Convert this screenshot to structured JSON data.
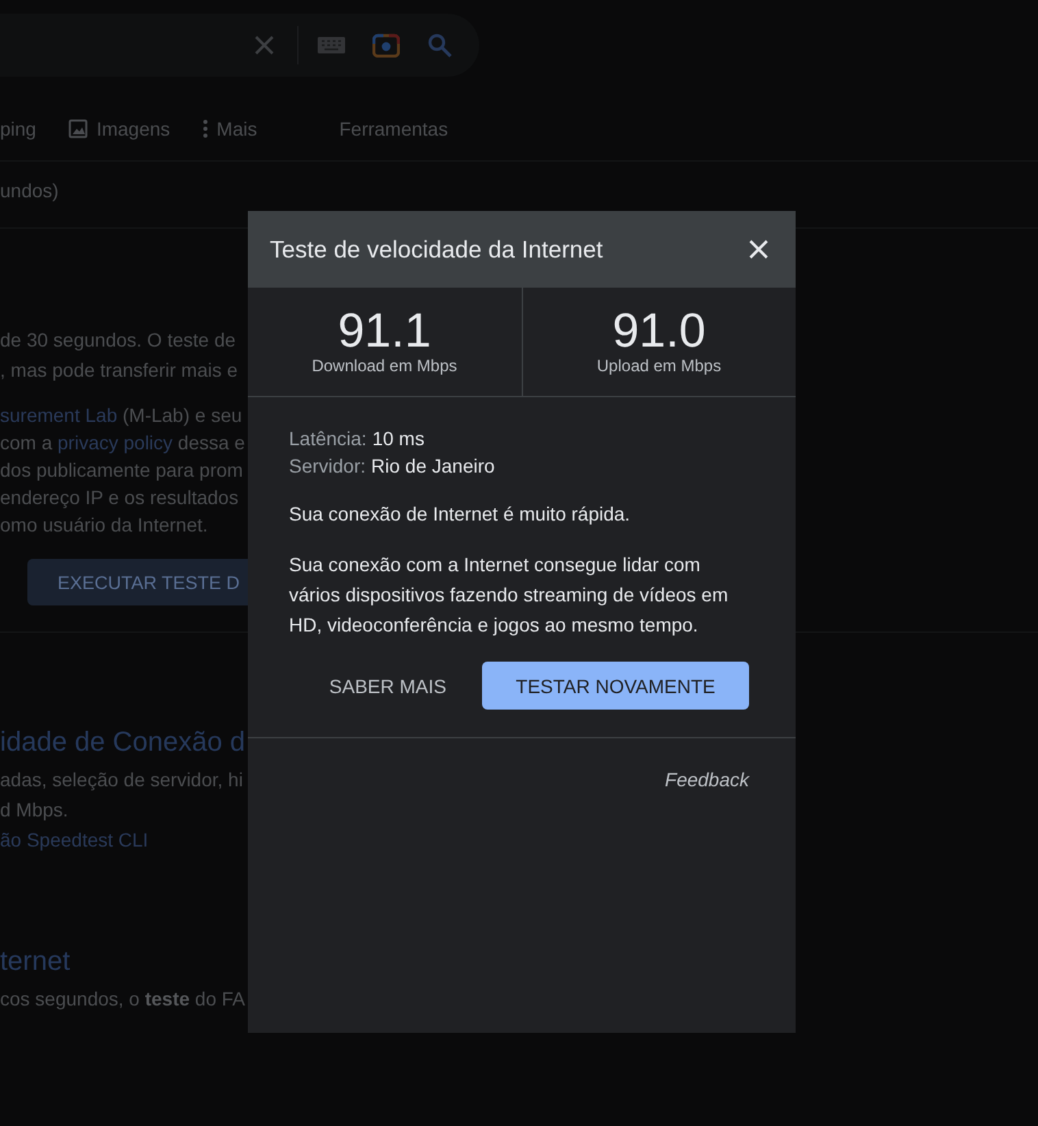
{
  "background": {
    "nav_tabs": [
      {
        "label": "ping",
        "kind": "plain"
      },
      {
        "label": "Imagens",
        "kind": "images"
      },
      {
        "label": "Mais",
        "kind": "more"
      },
      {
        "label": "Ferramentas",
        "kind": "tools"
      }
    ],
    "result_stats": "undos)",
    "snippet_paragraphs": [
      [
        [
          {
            "text": "de 30 segundos. O teste de",
            "link": false
          }
        ],
        [
          {
            "text": ", mas pode transferir mais e",
            "link": false
          }
        ]
      ],
      [
        [
          {
            "text": "surement Lab",
            "link": true
          },
          {
            "text": " (M-Lab) e seu",
            "link": false
          }
        ],
        [
          {
            "text": "com a ",
            "link": false
          },
          {
            "text": "privacy policy",
            "link": true
          },
          {
            "text": " dessa e",
            "link": false
          }
        ],
        [
          {
            "text": "dos publicamente para prom",
            "link": false
          }
        ],
        [
          {
            "text": "endereço IP e os resultados",
            "link": false
          }
        ],
        [
          {
            "text": "omo usuário da Internet.",
            "link": false
          }
        ]
      ]
    ],
    "run_button": "EXECUTAR TESTE D",
    "results": [
      {
        "title": "idade de Conexão d",
        "lines": [
          [
            {
              "text": "adas, seleção de servidor, hi",
              "link": false
            }
          ],
          [
            {
              "text": "d Mbps.",
              "link": false
            }
          ],
          [
            {
              "text": "ão Speedtest CLI",
              "link": true
            }
          ]
        ]
      },
      {
        "title": "ternet",
        "lines": [
          [
            {
              "text": "cos segundos, o **teste** do FA",
              "link": false
            }
          ]
        ]
      }
    ]
  },
  "dialog": {
    "title": "Teste de velocidade da Internet",
    "stats": [
      {
        "value": "91.1",
        "label": "Download em Mbps"
      },
      {
        "value": "91.0",
        "label": "Upload em Mbps"
      }
    ],
    "details": [
      {
        "label": "Latência:",
        "value": "10 ms"
      },
      {
        "label": "Servidor:",
        "value": "Rio de Janeiro"
      }
    ],
    "summary": "Sua conexão de Internet é muito rápida.",
    "description": "Sua conexão com a Internet consegue lidar com vários dispositivos fazendo streaming de vídeos em HD, videoconferência e jogos ao mesmo tempo.",
    "buttons": [
      {
        "label": "SABER MAIS",
        "kind": "text"
      },
      {
        "label": "TESTAR NOVAMENTE",
        "kind": "filled"
      }
    ],
    "feedback": "Feedback"
  }
}
